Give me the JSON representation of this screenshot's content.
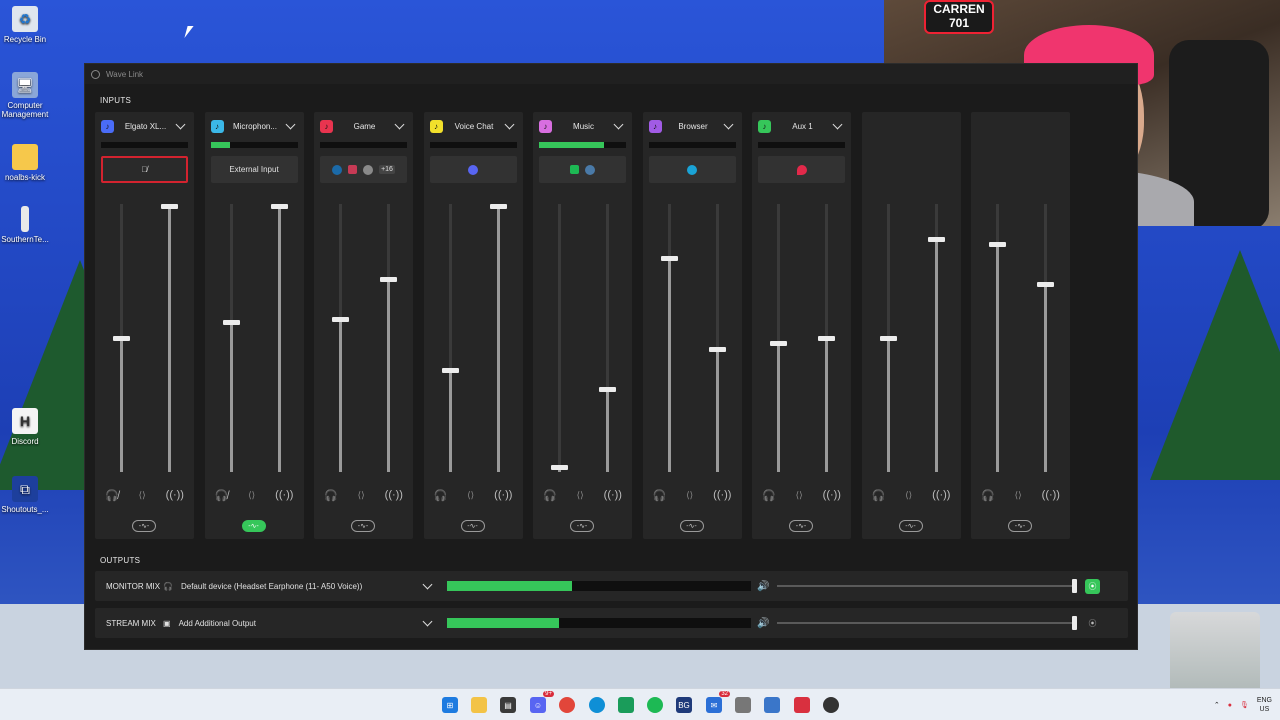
{
  "window": {
    "title": "Wave Link"
  },
  "desktop": {
    "icons": [
      {
        "label": "Recycle Bin"
      },
      {
        "label": "Computer Management"
      },
      {
        "label": "noalbs-kick"
      },
      {
        "label": "SouthernTe..."
      },
      {
        "label": "Discord"
      },
      {
        "label": "Shoutouts_..."
      }
    ]
  },
  "webcam": {
    "sign_text": "CARREN 701"
  },
  "inputs": {
    "label": "INPUTS",
    "channels": [
      {
        "name": "Elgato XL...",
        "color": "#4a6cf7",
        "source": "",
        "source_state": "muted",
        "meter": 0,
        "left_level": 0.5,
        "right_level": 1.0,
        "fx_on": false,
        "monitor_muted": true
      },
      {
        "name": "Microphon...",
        "color": "#3bb8e8",
        "source": "External Input",
        "source_state": "normal",
        "meter": 0.22,
        "left_level": 0.56,
        "right_level": 1.0,
        "fx_on": true,
        "monitor_muted": true
      },
      {
        "name": "Game",
        "color": "#e8344f",
        "source": "+16",
        "source_state": "apps",
        "meter": 0,
        "left_level": 0.57,
        "right_level": 0.72,
        "fx_on": false,
        "monitor_muted": false
      },
      {
        "name": "Voice Chat",
        "color": "#f2e02b",
        "source": "",
        "source_state": "apps",
        "meter": 0,
        "left_level": 0.38,
        "right_level": 1.0,
        "fx_on": false,
        "monitor_muted": false
      },
      {
        "name": "Music",
        "color": "#d86ee0",
        "source": "",
        "source_state": "apps",
        "meter": 0.75,
        "left_level": 0.02,
        "right_level": 0.31,
        "fx_on": false,
        "monitor_muted": false
      },
      {
        "name": "Browser",
        "color": "#a15be5",
        "source": "",
        "source_state": "apps",
        "meter": 0,
        "left_level": 0.8,
        "right_level": 0.46,
        "fx_on": false,
        "monitor_muted": false
      },
      {
        "name": "Aux 1",
        "color": "#36c65a",
        "source": "",
        "source_state": "apps",
        "meter": 0,
        "left_level": 0.48,
        "right_level": 0.5,
        "fx_on": false,
        "monitor_muted": false
      },
      {
        "name": "",
        "color": "#3de0d0",
        "source": "",
        "source_state": "hidden",
        "meter": 0,
        "left_level": 0.5,
        "right_level": 0.87,
        "fx_on": false,
        "monitor_muted": false
      },
      {
        "name": "",
        "color": "#888888",
        "source": "",
        "source_state": "hidden",
        "meter": 0,
        "left_level": 0.85,
        "right_level": 0.7,
        "fx_on": false,
        "monitor_muted": false
      }
    ]
  },
  "outputs": {
    "label": "OUTPUTS",
    "rows": [
      {
        "name": "MONITOR MIX",
        "device": "Default device (Headset Earphone (11- A50 Voice))",
        "device_icon": "headphones-icon",
        "meter": 0.41,
        "volume": 1.0,
        "button_active": true
      },
      {
        "name": "STREAM MIX",
        "device": "Add Additional Output",
        "device_icon": "speaker-icon",
        "meter": 0.37,
        "volume": 1.0,
        "button_active": false
      }
    ]
  },
  "taskbar": {
    "badges": {
      "discord": "9+",
      "mail": "32"
    },
    "lang": {
      "line1": "ENG",
      "line2": "US"
    }
  }
}
